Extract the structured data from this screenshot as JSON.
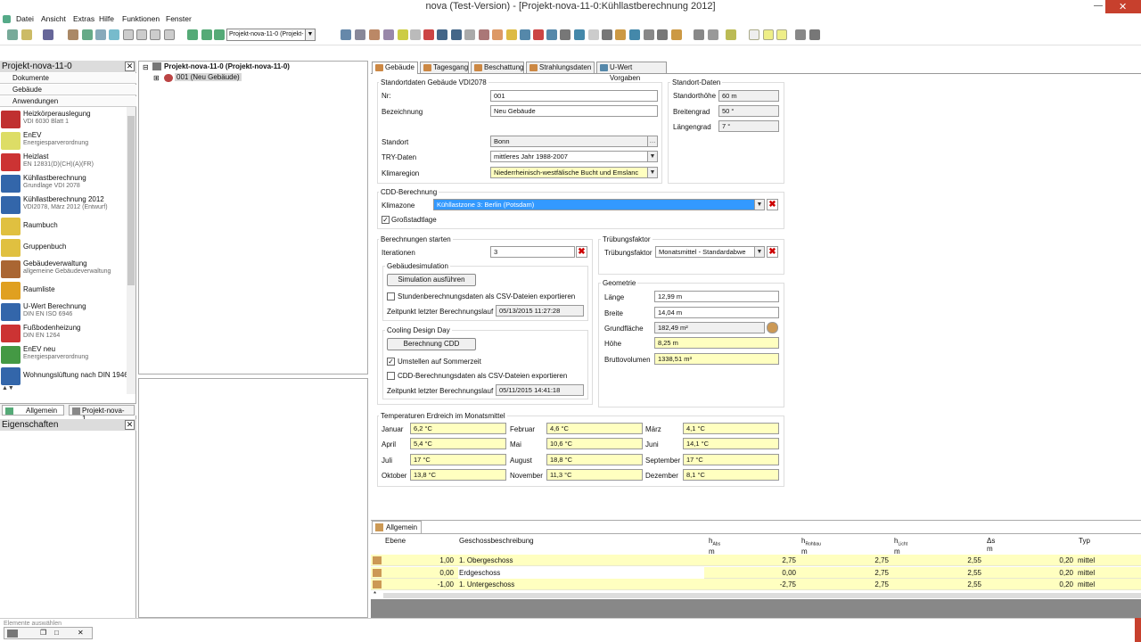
{
  "window": {
    "title": "nova (Test-Version) - [Projekt-nova-11-0:Kühllastberechnung 2012]"
  },
  "menu": [
    "Datei",
    "Ansicht",
    "Extras",
    "Hilfe",
    "Funktionen",
    "Fenster"
  ],
  "toolbar": {
    "project_select": "Projekt-nova-11-0 (Projekt-"
  },
  "left": {
    "project_title": "Projekt-nova-11-0",
    "sections": [
      "Dokumente",
      "Gebäude",
      "Anwendungen"
    ],
    "apps": [
      {
        "title": "Heizkörperauslegung",
        "sub": "VDI 6030 Blatt 1",
        "color": "#c03030"
      },
      {
        "title": "EnEV",
        "sub": "Energiesparverordnung",
        "color": "#dddd66"
      },
      {
        "title": "Heizlast",
        "sub": "EN 12831(D)(CH)(A)(FR)",
        "color": "#cc3333"
      },
      {
        "title": "Kühllastberechnung",
        "sub": "Grundlage VDI 2078",
        "color": "#3366aa"
      },
      {
        "title": "Kühllastberechnung 2012",
        "sub": "VDI2078, März 2012 (Entwurf)",
        "color": "#3366aa"
      },
      {
        "title": "Raumbuch",
        "sub": "",
        "color": "#e0c040"
      },
      {
        "title": "Gruppenbuch",
        "sub": "",
        "color": "#e0c040"
      },
      {
        "title": "Gebäudeverwaltung",
        "sub": "allgemeine Gebäudeverwaltung",
        "color": "#aa6633"
      },
      {
        "title": "Raumliste",
        "sub": "",
        "color": "#e0a020"
      },
      {
        "title": "U-Wert Berechnung",
        "sub": "DIN EN ISO 6946",
        "color": "#3366aa"
      },
      {
        "title": "Fußbodenheizung",
        "sub": "DIN EN 1264",
        "color": "#cc3333"
      },
      {
        "title": "EnEV neu",
        "sub": "Energiesparverordnung",
        "color": "#449944"
      },
      {
        "title": "Wohnungslüftung nach DIN 1946",
        "sub": "",
        "color": "#3366aa"
      }
    ],
    "tabs": [
      "Allgemein",
      "Projekt-nova-1..."
    ],
    "properties_title": "Eigenschaften"
  },
  "tree": {
    "root": "Projekt-nova-11-0 (Projekt-nova-11-0)",
    "child": "001 (Neu Gebäude)"
  },
  "tabs": [
    "Gebäude",
    "Tagesgang",
    "Beschattung",
    "Strahlungsdaten",
    "U-Wert Vorgaben"
  ],
  "standort": {
    "group": "Standortdaten Gebäude VDI2078",
    "nr_label": "Nr:",
    "nr": "001",
    "bez_label": "Bezeichnung",
    "bez": "Neu Gebäude",
    "ort_label": "Standort",
    "ort": "Bonn",
    "try_label": "TRY-Daten",
    "try": "mittleres Jahr 1988-2007",
    "klima_label": "Klimaregion",
    "klima": "Niederrheinisch-westfälische Bucht und Emslanc"
  },
  "standort_daten": {
    "group": "Standort-Daten",
    "hoehe_label": "Standorthöhe",
    "hoehe": "60 m",
    "breite_label": "Breitengrad",
    "breite": "50 °",
    "laenge_label": "Längengrad",
    "laenge": "7 °"
  },
  "cdd": {
    "group": "CDD-Berechnung",
    "zone_label": "Klimazone",
    "zone": "Kühllastzone 3: Berlin (Potsdam)",
    "stadt": "Großstadtlage"
  },
  "berech": {
    "group": "Berechnungen starten",
    "iter_label": "Iterationen",
    "iter": "3",
    "sim_group": "Gebäudesimulation",
    "sim_btn": "Simulation ausführen",
    "sim_csv": "Stundenberechnungsdaten als CSV-Dateien exportieren",
    "sim_time_label": "Zeitpunkt letzter Berechnungslauf",
    "sim_time": "05/13/2015 11:27:28",
    "cdd_group": "Cooling Design Day",
    "cdd_btn": "Berechnung CDD",
    "sommer": "Umstellen auf Sommerzeit",
    "cdd_csv": "CDD-Berechnungsdaten als CSV-Dateien exportieren",
    "cdd_time_label": "Zeitpunkt letzter Berechnungslauf",
    "cdd_time": "05/11/2015 14:41:18"
  },
  "truebung": {
    "group": "Trübungsfaktor",
    "label": "Trübungsfaktor",
    "value": "Monatsmittel - Standardabwe"
  },
  "geometrie": {
    "group": "Geometrie",
    "rows": [
      {
        "label": "Länge",
        "value": "12,99 m",
        "style": "white"
      },
      {
        "label": "Breite",
        "value": "14,04 m",
        "style": "white"
      },
      {
        "label": "Grundfläche",
        "value": "182,49 m²",
        "style": "gray"
      },
      {
        "label": "Höhe",
        "value": "8,25 m",
        "style": "yellow"
      },
      {
        "label": "Bruttovolumen",
        "value": "1338,51 m³",
        "style": "yellow"
      }
    ]
  },
  "temperaturen": {
    "group": "Temperaturen Erdreich im Monatsmittel",
    "months": [
      {
        "label": "Januar",
        "value": "6,2 °C"
      },
      {
        "label": "Februar",
        "value": "4,6 °C"
      },
      {
        "label": "März",
        "value": "4,1 °C"
      },
      {
        "label": "April",
        "value": "5,4 °C"
      },
      {
        "label": "Mai",
        "value": "10,6 °C"
      },
      {
        "label": "Juni",
        "value": "14,1 °C"
      },
      {
        "label": "Juli",
        "value": "17 °C"
      },
      {
        "label": "August",
        "value": "18,8 °C"
      },
      {
        "label": "September",
        "value": "17 °C"
      },
      {
        "label": "Oktober",
        "value": "13,8 °C"
      },
      {
        "label": "November",
        "value": "11,3 °C"
      },
      {
        "label": "Dezember",
        "value": "8,1 °C"
      }
    ]
  },
  "bottom": {
    "tab": "Allgemein",
    "headers": {
      "ebene": "Ebene",
      "beschr": "Geschossbeschreibung",
      "habs": "h",
      "habs_sub": "Abs",
      "hrohbau": "h",
      "hrohbau_sub": "Rohbau",
      "hlicht": "h",
      "hlicht_sub": "Licht",
      "ds": "Δs",
      "typ": "Typ",
      "unit": "m"
    },
    "rows": [
      {
        "ebene": "1,00",
        "beschr": "1. Obergeschoss",
        "habs": "2,75",
        "hrohbau": "2,75",
        "hlicht": "2,55",
        "ds": "0,20",
        "typ": "mittel"
      },
      {
        "ebene": "0,00",
        "beschr": "Erdgeschoss",
        "habs": "0,00",
        "hrohbau": "2,75",
        "hlicht": "2,55",
        "ds": "0,20",
        "typ": "mittel"
      },
      {
        "ebene": "-1,00",
        "beschr": "1. Untergeschoss",
        "habs": "-2,75",
        "hrohbau": "2,75",
        "hlicht": "2,55",
        "ds": "0,20",
        "typ": "mittel"
      }
    ],
    "newrow": "*"
  },
  "status": {
    "text": "Elemente auswählen"
  }
}
